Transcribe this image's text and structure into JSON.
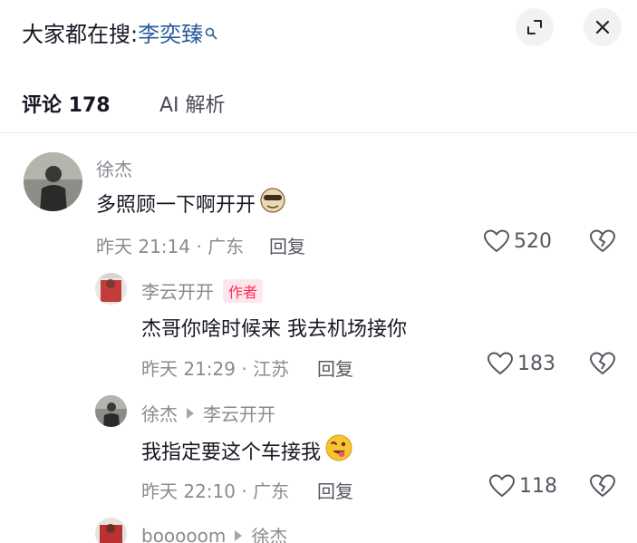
{
  "header": {
    "search_prefix": "大家都在搜:",
    "search_term": "李奕臻"
  },
  "tabs": [
    {
      "label": "评论 178"
    },
    {
      "label": "AI 解析"
    }
  ],
  "comments": [
    {
      "user": "徐杰",
      "text": "多照顾一下啊开开",
      "meta": "昨天 21:14 · 广东",
      "reply_label": "回复",
      "likes": "520"
    },
    {
      "user": "李云开开",
      "badge": "作者",
      "text": "杰哥你啥时候来 我去机场接你",
      "meta": "昨天 21:29 · 江苏",
      "reply_label": "回复",
      "likes": "183"
    },
    {
      "user": "徐杰",
      "reply_to": "李云开开",
      "text": "我指定要这个车接我",
      "meta": "昨天 22:10 · 广东",
      "reply_label": "回复",
      "likes": "118"
    },
    {
      "user": "booooom",
      "reply_to": "徐杰"
    }
  ],
  "colors": {
    "accent_link": "#2a5c9a",
    "author_badge": "#fe2c55"
  }
}
